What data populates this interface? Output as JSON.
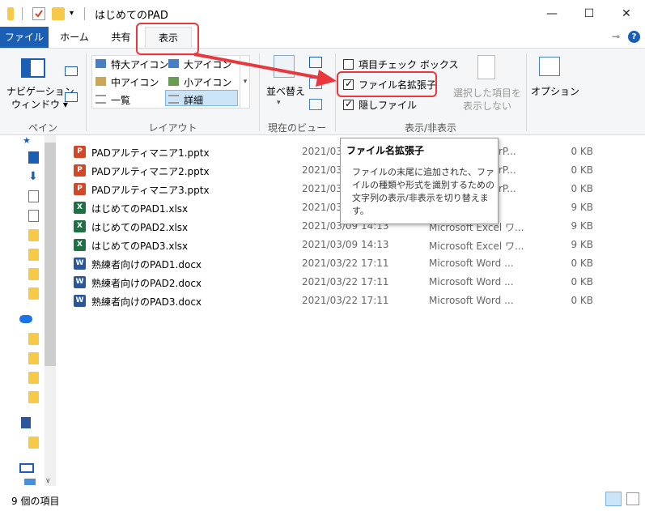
{
  "window": {
    "title": "はじめてのPAD",
    "minimize": "—",
    "maximize": "☐",
    "close": "✕"
  },
  "tabs": [
    {
      "label": "ファイル"
    },
    {
      "label": "ホーム"
    },
    {
      "label": "共有"
    },
    {
      "label": "表示"
    }
  ],
  "ribbon": {
    "panes": {
      "nav_pane_line1": "ナビゲーション",
      "nav_pane_line2": "ウィンドウ ▾",
      "group": "ペイン"
    },
    "layout": {
      "items": [
        "特大アイコン",
        "大アイコン",
        "中アイコン",
        "小アイコン",
        "一覧",
        "詳細"
      ],
      "group": "レイアウト"
    },
    "current_view": {
      "sort": "並べ替え",
      "group": "現在のビュー"
    },
    "show_hide": {
      "checkbox_items": "項目チェック ボックス",
      "file_extensions": "ファイル名拡張子",
      "hidden_files": "隠しファイル",
      "hide_selected_line1": "選択した項目を",
      "hide_selected_line2": "表示しない",
      "group": "表示/非表示"
    },
    "options": "オプション"
  },
  "files": [
    {
      "name": "PADアルティマニア1.pptx",
      "date": "2021/03",
      "type": "",
      "size": "0 KB",
      "kind": "ppt"
    },
    {
      "name": "PADアルティマニア2.pptx",
      "date": "2021/03",
      "type": "",
      "size": "0 KB",
      "kind": "ppt"
    },
    {
      "name": "PADアルティマニア3.pptx",
      "date": "2021/03",
      "type": "",
      "size": "0 KB",
      "kind": "ppt"
    },
    {
      "name": "はじめてのPAD1.xlsx",
      "date": "2021/03",
      "type": "",
      "size": "9 KB",
      "kind": "xls"
    },
    {
      "name": "はじめてのPAD2.xlsx",
      "date": "2021/03/09 14:13",
      "type": "Microsoft Excel ワ...",
      "size": "9 KB",
      "kind": "xls"
    },
    {
      "name": "はじめてのPAD3.xlsx",
      "date": "2021/03/09 14:13",
      "type": "Microsoft Excel ワ...",
      "size": "9 KB",
      "kind": "xls"
    },
    {
      "name": "熟練者向けのPAD1.docx",
      "date": "2021/03/22 17:11",
      "type": "Microsoft Word ...",
      "size": "0 KB",
      "kind": "doc"
    },
    {
      "name": "熟練者向けのPAD2.docx",
      "date": "2021/03/22 17:11",
      "type": "Microsoft Word ...",
      "size": "0 KB",
      "kind": "doc"
    },
    {
      "name": "熟練者向けのPAD3.docx",
      "date": "2021/03/22 17:11",
      "type": "Microsoft Word ...",
      "size": "0 KB",
      "kind": "doc"
    }
  ],
  "partial_types": [
    "rP...",
    "rP...",
    "rP..."
  ],
  "tooltip": {
    "title": "ファイル名拡張子",
    "body": "ファイルの末尾に追加された、ファイルの種類や形式を識別するための文字列の表示/非表示を切り替えます。"
  },
  "status": {
    "item_count": "9 個の項目"
  },
  "colors": {
    "accent": "#1a5fb4",
    "highlight": "#e8383d",
    "ppt": "#d24726",
    "xls": "#1e7145",
    "doc": "#2b579a"
  }
}
